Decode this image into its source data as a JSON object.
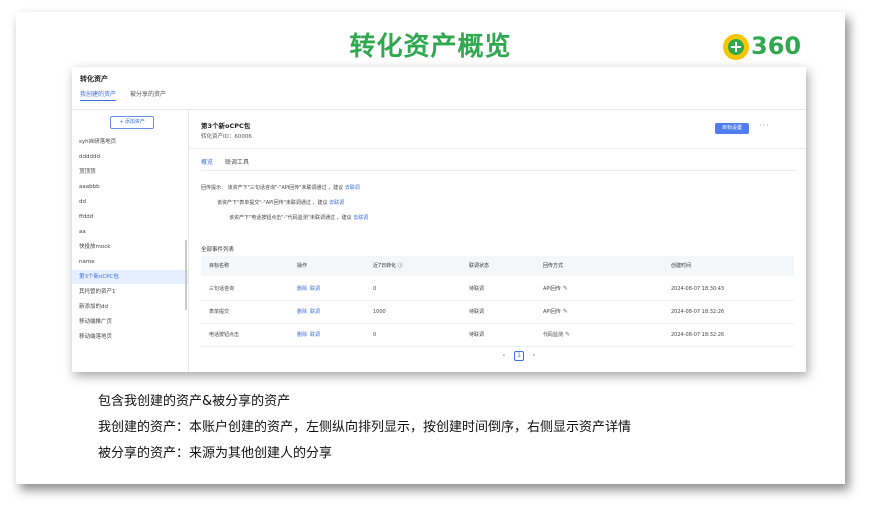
{
  "slide": {
    "title": "转化资产概览",
    "logo_text": "360",
    "captions": [
      "包含我创建的资产&被分享的资产",
      "我创建的资产：本账户创建的资产，左侧纵向排列显示，按创建时间倒序，右侧显示资产详情",
      "被分享的资产：来源为其他创建人的分享"
    ]
  },
  "app": {
    "title": "转化资产",
    "top_tabs": [
      "我创建的资产",
      "被分享的资产"
    ],
    "active_top_tab": 0
  },
  "sidebar": {
    "add_button": "+ 添加资产",
    "items": [
      "syh自研落地页",
      "dddddd",
      "顶顶顶",
      "aaabbb",
      "dd",
      "ffddd",
      "aa",
      "快投放mock",
      "name",
      "第3个新oCPC包",
      "其托管的资产1",
      "新添加的dd",
      "移动端推广页",
      "移动端落地页"
    ],
    "active_index": 9
  },
  "detail": {
    "name": "第3个新oCPC包",
    "id_label": "转化资产ID：",
    "id_value": "60006",
    "target_button": "目标设置",
    "more_icon": "ellipsis-icon",
    "tabs": [
      "概览",
      "联调工具"
    ],
    "active_tab": 0,
    "tips": [
      {
        "prefix": "回传提示：",
        "text": "该资产下\"三句话咨询\"-\"API回传\"未联调通过 ，建议",
        "link": "去联调"
      },
      {
        "prefix": "",
        "text": "该资产下\"表单提交\"-\"API回传\"未联调通过 ，建议",
        "link": "去联调"
      },
      {
        "prefix": "",
        "text": "该资产下\"电话按钮点击\"-\"代码监测\"未联调通过 ，建议",
        "link": "去联调"
      }
    ],
    "events_title": "全部事件列表",
    "table": {
      "headers": [
        "目标名称",
        "操作",
        "近7日转化 ⓘ",
        "联调状态",
        "回传方式",
        "创建时间"
      ],
      "rows": [
        {
          "name": "三句话咨询",
          "op_delete": "删除",
          "op_debug": "联调",
          "conv7d": "0",
          "status": "待联调",
          "method": "API回传",
          "created": "2024-08-07 18:30:43"
        },
        {
          "name": "表单提交",
          "op_delete": "删除",
          "op_debug": "联调",
          "conv7d": "1000",
          "status": "待联调",
          "method": "API回传",
          "created": "2024-08-07 18:32:26"
        },
        {
          "name": "电话按钮点击",
          "op_delete": "删除",
          "op_debug": "联调",
          "conv7d": "0",
          "status": "待联调",
          "method": "代码监测",
          "created": "2024-08-07 18:32:26"
        }
      ]
    },
    "pagination": {
      "prev": "‹",
      "current": "1",
      "next": "›"
    }
  },
  "colors": {
    "brand_green": "#2fa84f",
    "accent_blue": "#4f7df0",
    "logo_yellow": "#f7c600"
  }
}
